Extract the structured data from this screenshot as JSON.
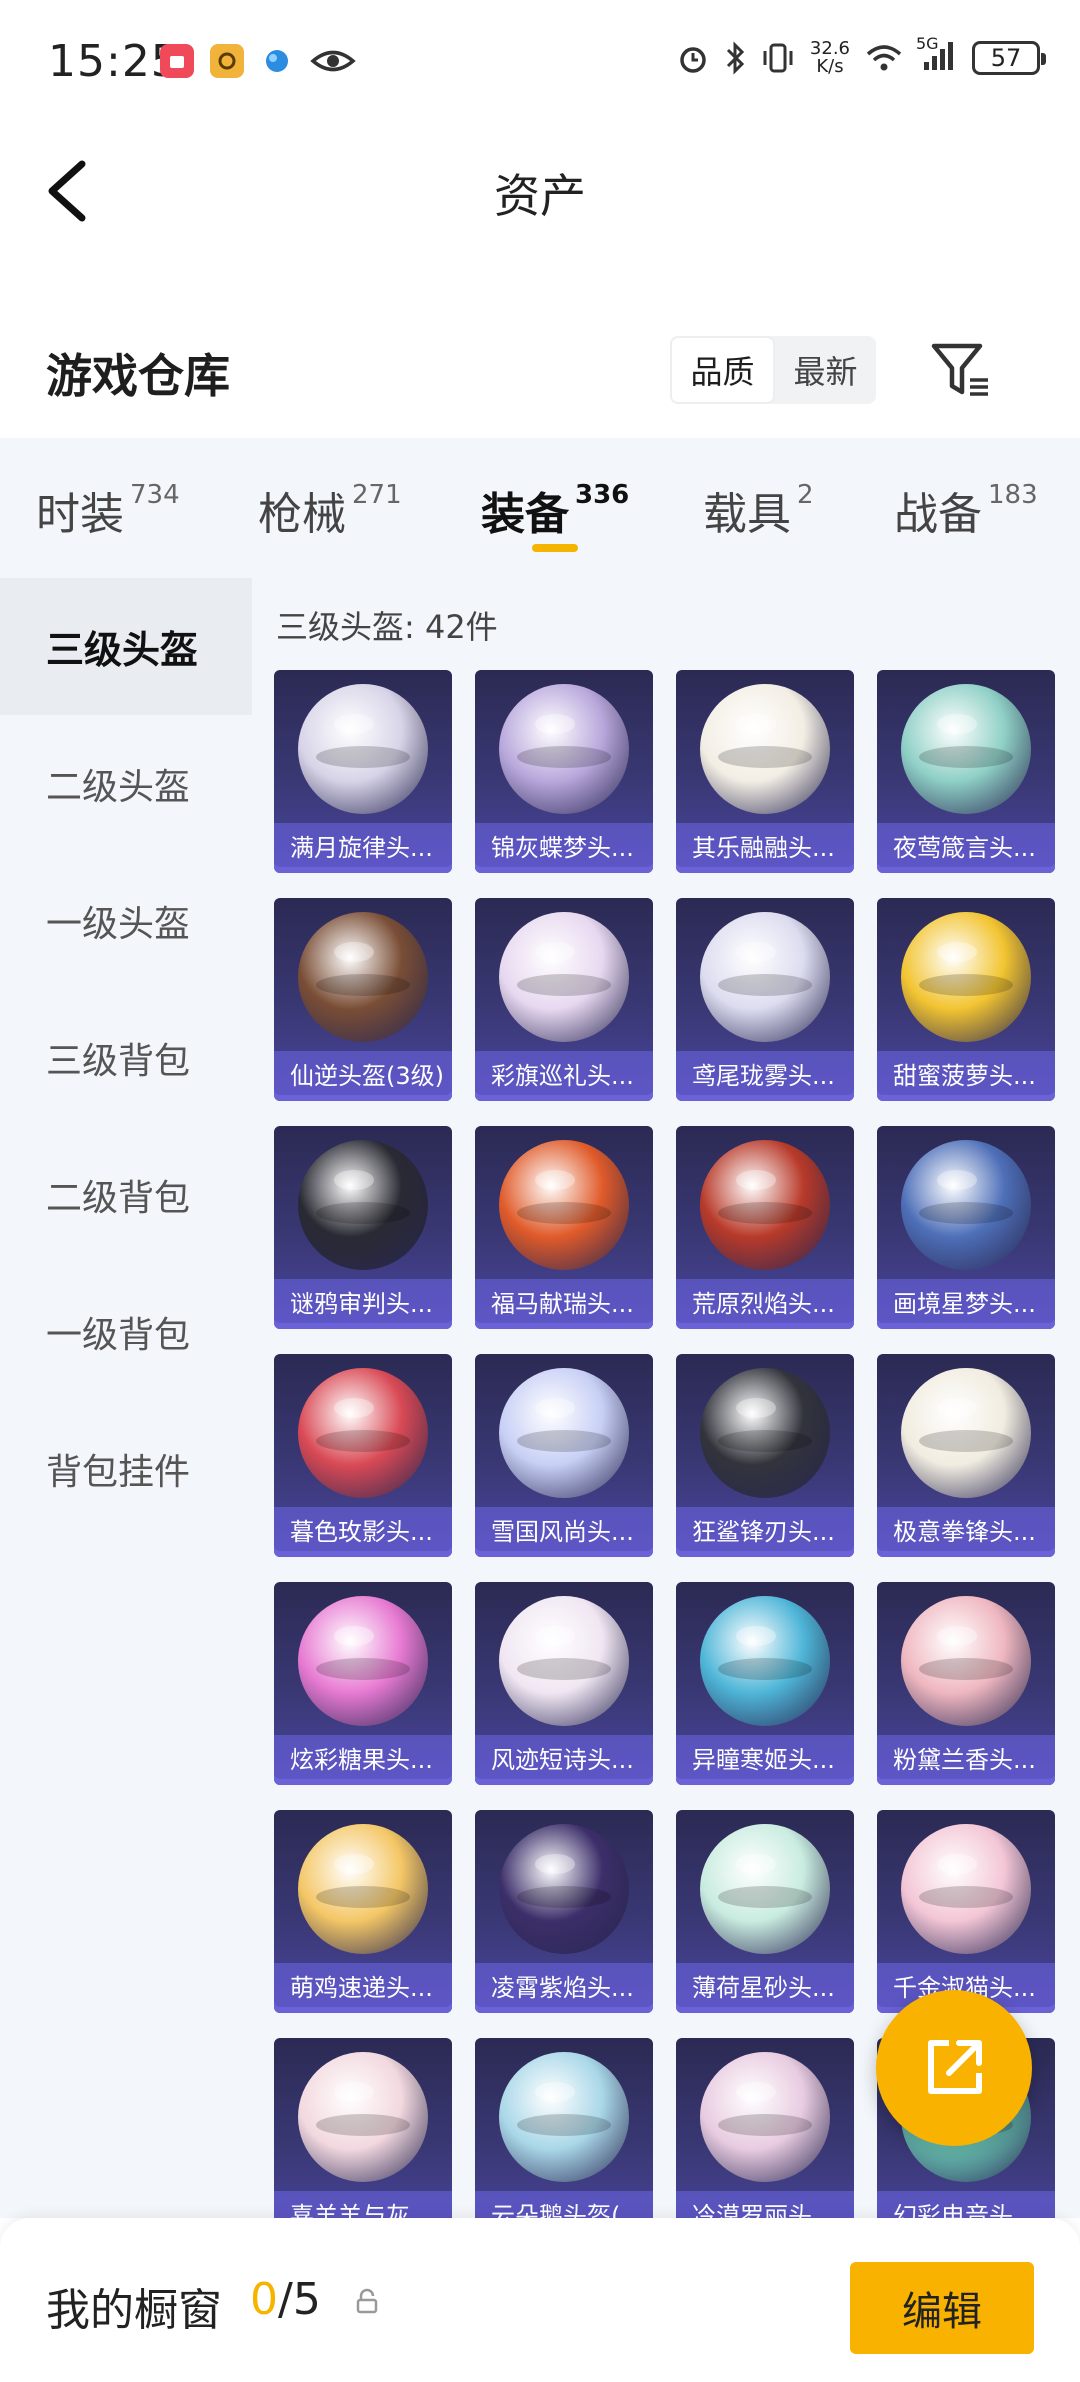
{
  "status": {
    "time": "15:25",
    "net_speed_top": "32.6",
    "net_speed_bottom": "K/s",
    "network": "5G",
    "battery": "57",
    "left_icons": [
      "app-red-icon",
      "app-gold-icon",
      "app-blue-icon",
      "eye-icon"
    ],
    "right_icons": [
      "alarm-icon",
      "bluetooth-icon",
      "vibrate-icon",
      "wifi-icon",
      "signal-icon"
    ]
  },
  "header": {
    "title": "资产",
    "back_icon": "chevron-left-icon"
  },
  "warehouse": {
    "title": "游戏仓库",
    "sort_options": [
      "品质",
      "最新"
    ],
    "selected_sort": "品质",
    "filter_icon": "filter-icon"
  },
  "tabs": [
    {
      "label": "时装",
      "count": "734"
    },
    {
      "label": "枪械",
      "count": "271"
    },
    {
      "label": "装备",
      "count": "336",
      "active": true
    },
    {
      "label": "载具",
      "count": "2"
    },
    {
      "label": "战备",
      "count": "183"
    }
  ],
  "sidebar": {
    "items": [
      {
        "label": "三级头盔",
        "active": true
      },
      {
        "label": "二级头盔"
      },
      {
        "label": "一级头盔"
      },
      {
        "label": "三级背包"
      },
      {
        "label": "二级背包"
      },
      {
        "label": "一级背包"
      },
      {
        "label": "背包挂件"
      }
    ]
  },
  "content": {
    "count_label": "三级头盔: 42件",
    "items": [
      {
        "name": "满月旋律头...",
        "color": "#d8d4e8"
      },
      {
        "name": "锦灰蝶梦头...",
        "color": "#b9a8dc"
      },
      {
        "name": "其乐融融头...",
        "color": "#f3eee4"
      },
      {
        "name": "夜莺箴言头...",
        "color": "#8fd0c6"
      },
      {
        "name": "仙逆头盔(3级)",
        "color": "#7a4e36"
      },
      {
        "name": "彩旗巡礼头...",
        "color": "#e7d8f0"
      },
      {
        "name": "鸢尾珑雾头...",
        "color": "#dcdcf0"
      },
      {
        "name": "甜蜜菠萝头...",
        "color": "#f2c431"
      },
      {
        "name": "谜鸦审判头...",
        "color": "#2a2a34"
      },
      {
        "name": "福马献瑞头...",
        "color": "#e05b2a"
      },
      {
        "name": "荒原烈焰头...",
        "color": "#b83a2a"
      },
      {
        "name": "画境星梦头...",
        "color": "#4e6fb8"
      },
      {
        "name": "暮色玫影头...",
        "color": "#d94a55"
      },
      {
        "name": "雪国风尚头...",
        "color": "#c7cff5"
      },
      {
        "name": "狂鲨锋刃头...",
        "color": "#32343c"
      },
      {
        "name": "极意拳锋头...",
        "color": "#f1ece0"
      },
      {
        "name": "炫彩糖果头...",
        "color": "#e77ad2"
      },
      {
        "name": "风迹短诗头...",
        "color": "#f0e6f2"
      },
      {
        "name": "异瞳寒姬头...",
        "color": "#4fb6d8"
      },
      {
        "name": "粉黛兰香头...",
        "color": "#efb7c0"
      },
      {
        "name": "萌鸡速递头...",
        "color": "#f4c766"
      },
      {
        "name": "凌霄紫焰头...",
        "color": "#3c2f6a"
      },
      {
        "name": "薄荷星砂头...",
        "color": "#c9ece0"
      },
      {
        "name": "千金淑猫头...",
        "color": "#f3c6d6"
      },
      {
        "name": "喜羊羊与灰...",
        "color": "#f2d8df"
      },
      {
        "name": "云朵鹅头盔(...",
        "color": "#a9d7e8"
      },
      {
        "name": "冷漠罗丽头...",
        "color": "#e8cbe0"
      },
      {
        "name": "幻彩电音头...",
        "color": "#6cc7b8"
      }
    ]
  },
  "fab": {
    "icon": "share-external-icon"
  },
  "bottom": {
    "label": "我的橱窗",
    "count_current": "0",
    "count_total": "/5",
    "lock_icon": "lock-icon",
    "edit_label": "编辑"
  }
}
